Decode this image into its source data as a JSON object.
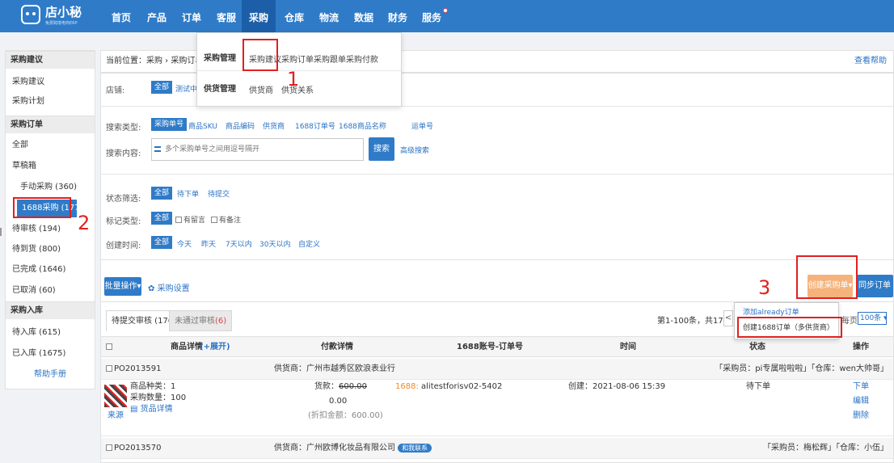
{
  "brand": {
    "name": "店小秘",
    "tagline": "免费跨境电商ERP"
  },
  "nav": [
    "首页",
    "产品",
    "订单",
    "客服",
    "采购",
    "仓库",
    "物流",
    "数据",
    "财务",
    "服务"
  ],
  "purchase_menu": {
    "group1_label": "采购管理",
    "group1_items": [
      "采购建议",
      "采购订单",
      "采购跟单",
      "采购付款"
    ],
    "group2_label": "供货管理",
    "group2_items": [
      "供货商",
      "供货关系"
    ]
  },
  "sidebar": {
    "h1": "采购建议",
    "i1": "采购建议",
    "i2": "采购计划",
    "h2": "采购订单",
    "i3": "全部",
    "i4": "草稿箱",
    "i5": "手动采购 (360)",
    "i6": "1688采购 (1770)",
    "i7": "待审核 (194)",
    "i8": "待到货 (800)",
    "i9": "已完成 (1646)",
    "i10": "已取消 (60)",
    "h3": "采购入库",
    "i11": "待入库 (615)",
    "i12": "已入库 (1675)",
    "help": "帮助手册"
  },
  "breadcrumb": "当前位置：采购 › 采购订单 › 草稿",
  "help_link": "查看帮助",
  "filters": {
    "shop_label": "店铺:",
    "shop_all": "全部",
    "shop_test": "测试中",
    "type_label": "搜索类型:",
    "types": [
      "采购单号",
      "商品SKU",
      "商品编码",
      "供货商",
      "1688订单号",
      "1688商品名称",
      "运单号"
    ],
    "content_label": "搜索内容:",
    "search_placeholder": "多个采购单号之间用逗号隔开",
    "search_btn": "搜索",
    "advanced": "高级搜索",
    "status_label": "状态筛选:",
    "status_all": "全部",
    "status_opts": [
      "待下单",
      "待提交"
    ],
    "mark_label": "标记类型:",
    "mark_all": "全部",
    "mark_opts": [
      "有留言",
      "有备注"
    ],
    "time_label": "创建时间:",
    "time_all": "全部",
    "time_opts": [
      "今天",
      "昨天",
      "7天以内",
      "30天以内",
      "自定义"
    ]
  },
  "actions": {
    "batch": "批量操作▾",
    "settings": "采购设置",
    "create": "创建采购单▾",
    "sync": "同步订单"
  },
  "create_dropdown": [
    "添加already订单",
    "创建1688订单（多供货商）"
  ],
  "tabs": {
    "pending": "待提交审核 (1764)",
    "rejected_label": "未通过审核",
    "rejected_count": "(6)"
  },
  "pager": {
    "info": "第1-100条，共1764条",
    "box": "<",
    "per_label": "每页",
    "per_value": "100条 ▾"
  },
  "table": {
    "headers": [
      "商品详情",
      "(+展开)",
      "付款详情",
      "1688账号-订单号",
      "时间",
      "状态",
      "操作"
    ]
  },
  "orders": [
    {
      "po": "PO2013591",
      "supplier": "供货商：广州市越秀区欧浪表业行",
      "buyer": "「采购员：pi专属啦啦啦」「仓库：wen大帅哥」",
      "kinds": "商品种类：1",
      "qty": "采购数量：100",
      "goods_detail": "货品详情",
      "source": "来源",
      "price_label": "货款：",
      "price": "600.00",
      "freight": "0.00",
      "discount": "(折扣金额：600.00)",
      "acct_prefix": "1688:",
      "acct": "alitestforisv02-5402",
      "created": "创建：2021-08-06 15:39",
      "status": "待下单",
      "ops": [
        "下单",
        "编辑",
        "删除"
      ]
    },
    {
      "po": "PO2013570",
      "supplier": "供货商：广州欧博化妆品有限公司",
      "badge": "和我联系",
      "buyer": "「采购员：梅松辉」「仓库：小伍」"
    }
  ],
  "annotations": [
    "1",
    "2",
    "3"
  ],
  "colors": {
    "nav_bg": "#2f7bc8",
    "nav_active": "#1c5fa8",
    "primary": "#2f7bc8",
    "create_btn": "#f5b27a",
    "highlight": "#e02020"
  }
}
